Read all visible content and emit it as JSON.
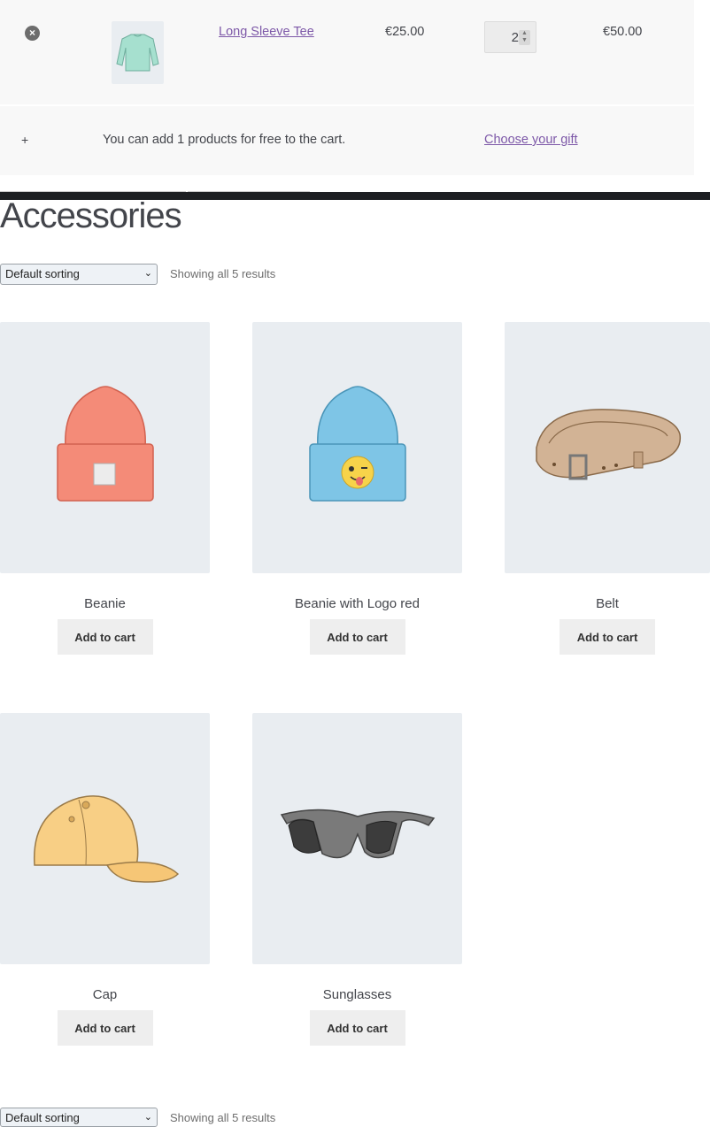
{
  "cart": {
    "remove_icon": "×",
    "product_name": "Long Sleeve Tee",
    "price": "€25.00",
    "quantity": "2",
    "subtotal": "€50.00"
  },
  "gift": {
    "plus": "+",
    "text": "You can add 1 products for free to the cart.",
    "link": "Choose your gift"
  },
  "page": {
    "title": "Accessories"
  },
  "toolbar_top": {
    "sort_selected": "Default sorting",
    "result_count": "Showing all 5 results"
  },
  "toolbar_bottom": {
    "sort_selected": "Default sorting",
    "result_count": "Showing all 5 results"
  },
  "products": [
    {
      "name": "Beanie",
      "button": "Add to cart",
      "image": "beanie-orange-icon"
    },
    {
      "name": "Beanie with Logo red",
      "button": "Add to cart",
      "image": "beanie-blue-logo-icon"
    },
    {
      "name": "Belt",
      "button": "Add to cart",
      "image": "belt-icon"
    },
    {
      "name": "Cap",
      "button": "Add to cart",
      "image": "cap-icon"
    },
    {
      "name": "Sunglasses",
      "button": "Add to cart",
      "image": "sunglasses-icon"
    }
  ],
  "colors": {
    "link": "#7d58a8",
    "text": "#43454b",
    "card_bg": "#e9edf1",
    "button_bg": "#eeeeee",
    "dark_bar": "#1d1f22"
  }
}
